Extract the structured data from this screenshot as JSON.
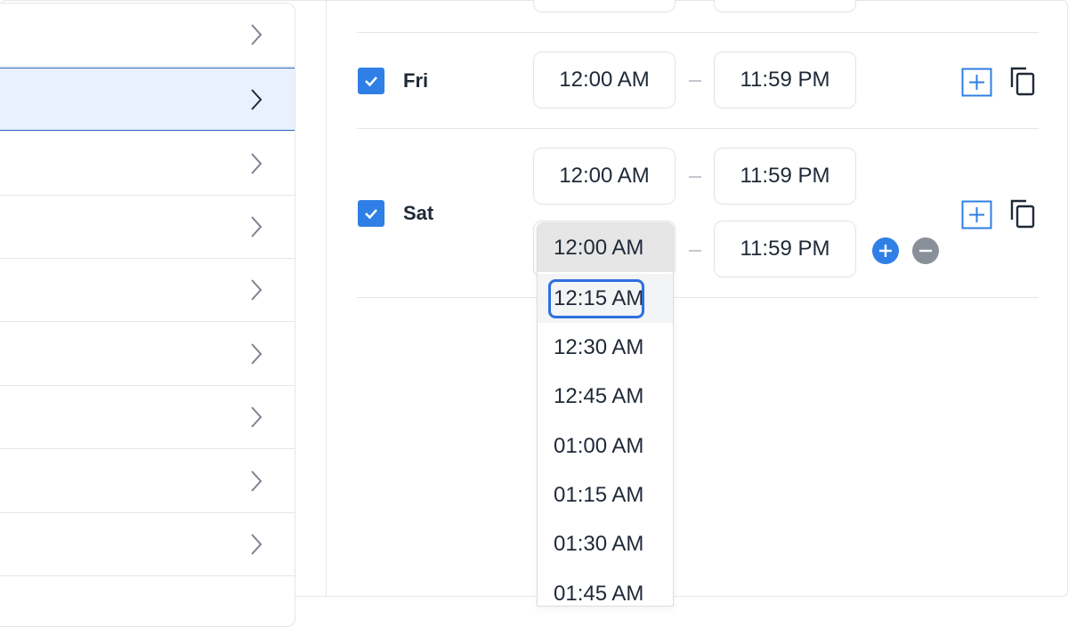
{
  "schedule": {
    "fri": {
      "day": "Fri",
      "checked": true,
      "start": "12:00 AM",
      "end": "11:59 PM"
    },
    "sat": {
      "day": "Sat",
      "checked": true,
      "slot1": {
        "start": "12:00 AM",
        "end": "11:59 PM"
      },
      "slot2": {
        "start": "12:00 AM",
        "end": "11:59 PM"
      }
    }
  },
  "dropdown": {
    "selected": "12:00 AM",
    "highlighted": "12:15 AM",
    "options": [
      "12:00 AM",
      "12:15 AM",
      "12:30 AM",
      "12:45 AM",
      "01:00 AM",
      "01:15 AM",
      "01:30 AM",
      "01:45 AM"
    ]
  },
  "icons": {
    "list_chevron": "chevron-right-icon",
    "add": "plus-square-icon",
    "copy": "copy-icon",
    "add_slot": "plus-circle-icon",
    "remove_slot": "minus-circle-icon",
    "check": "check-icon"
  },
  "colors": {
    "accent": "#2f7fe6",
    "selected_row": "#e8f1fd",
    "remove": "#8a9099",
    "focus": "#2f6fe0"
  }
}
